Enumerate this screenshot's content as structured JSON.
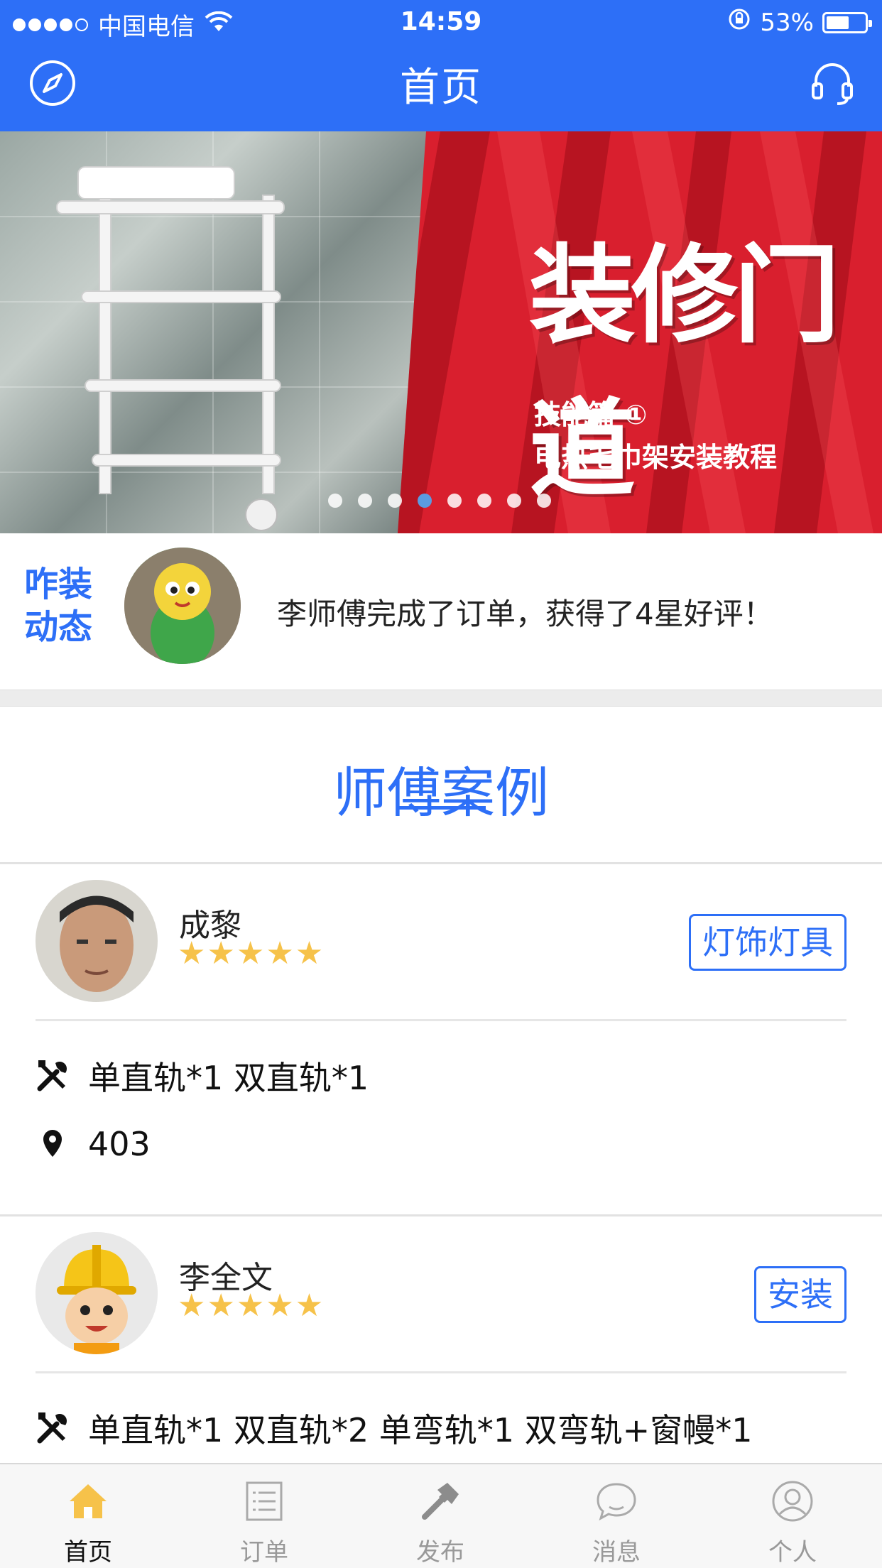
{
  "status_bar": {
    "carrier": "中国电信",
    "time": "14:59",
    "battery": "53%",
    "battery_level": 0.53
  },
  "nav": {
    "title": "首页",
    "left_icon": "compass-icon",
    "right_icon": "headset-icon"
  },
  "banner": {
    "brand_text": "装修门道",
    "subtitle_1": "技能篇 ①",
    "subtitle_2": "电热毛巾架安装教程",
    "page_count": 8,
    "active_page": 4
  },
  "news": {
    "label_line1": "咋装",
    "label_line2": "动态",
    "message": "李师傅完成了订单，获得了4星好评！"
  },
  "section": {
    "title": "师傅案例"
  },
  "cases": [
    {
      "name": "成黎",
      "stars": "★★★★★",
      "rating": 5,
      "tag": "灯饰灯具",
      "items": "单直轨*1  双直轨*1",
      "location": "403"
    },
    {
      "name": "李全文",
      "stars": "★★★★★",
      "rating": 5,
      "tag": "安装",
      "items": "单直轨*1  双直轨*2  单弯轨*1  双弯轨+窗幔*1"
    }
  ],
  "tabbar": {
    "tabs": [
      {
        "label": "首页",
        "icon": "home-icon",
        "active": true
      },
      {
        "label": "订单",
        "icon": "list-icon",
        "active": false
      },
      {
        "label": "发布",
        "icon": "hammer-icon",
        "active": false
      },
      {
        "label": "消息",
        "icon": "chat-icon",
        "active": false
      },
      {
        "label": "个人",
        "icon": "person-icon",
        "active": false
      }
    ]
  },
  "colors": {
    "primary": "#2d6ff7",
    "star": "#f6c24a",
    "home_icon": "#f6c24a",
    "banner_red": "#d91f2e"
  }
}
